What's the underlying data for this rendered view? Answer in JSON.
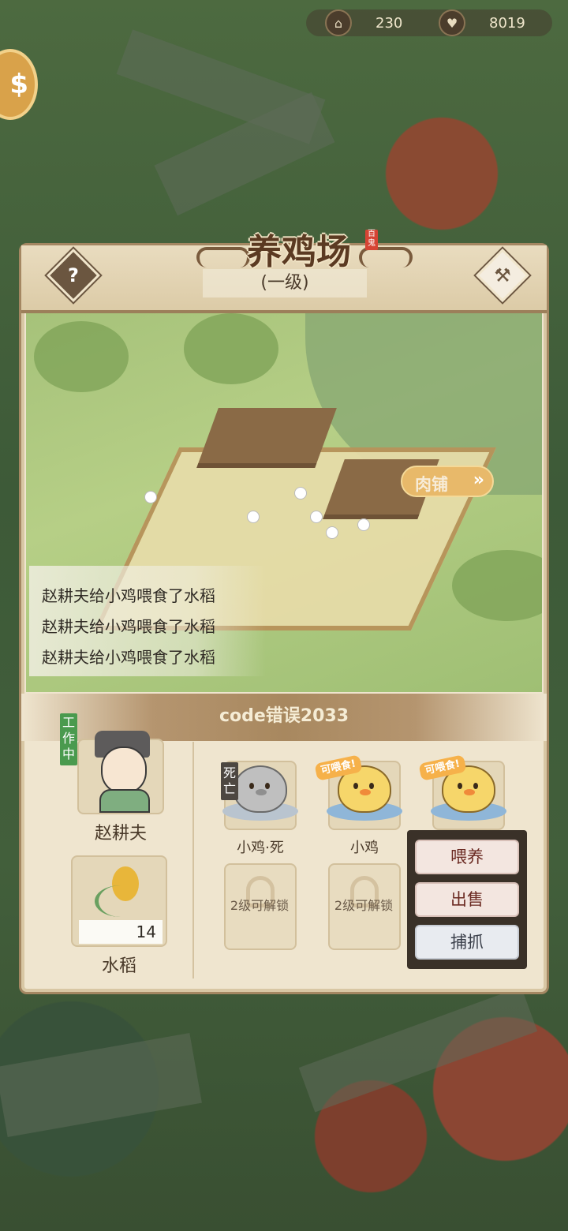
{
  "currency": {
    "coins": "230",
    "hearts": "8019",
    "coin_icon": "temple-icon",
    "heart_icon": "heart-icon"
  },
  "panel": {
    "title": "养鸡场",
    "seal": "百鬼",
    "level": "(一级)",
    "help_icon": "?",
    "build_icon": "hammer-icon"
  },
  "log": {
    "lines": [
      "赵耕夫给小鸡喂食了水稻",
      "赵耕夫给小鸡喂食了水稻",
      "赵耕夫给小鸡喂食了水稻"
    ]
  },
  "section": {
    "subtitle": "code错误2033",
    "shop_label": "肉铺",
    "shop_arrow": "»"
  },
  "worker": {
    "status": "工作中",
    "name": "赵耕夫"
  },
  "feed": {
    "name": "水稻",
    "quantity": "14"
  },
  "animals": [
    {
      "name": "小鸡·死",
      "state_tag": "死亡",
      "dead": true
    },
    {
      "name": "小鸡",
      "state_tag": "可喂食!",
      "dead": false
    },
    {
      "name": "",
      "state_tag": "可喂食!",
      "dead": false
    }
  ],
  "locked_slots": [
    "2级可解锁",
    "2级可解锁"
  ],
  "actions": {
    "feed": "喂养",
    "sell": "出售",
    "catch": "捕抓"
  },
  "colors": {
    "panel_bg": "#efe5cf",
    "border": "#a48762",
    "work_tag": "#4a9a4e",
    "hungry_tag": "#f6b14a"
  }
}
